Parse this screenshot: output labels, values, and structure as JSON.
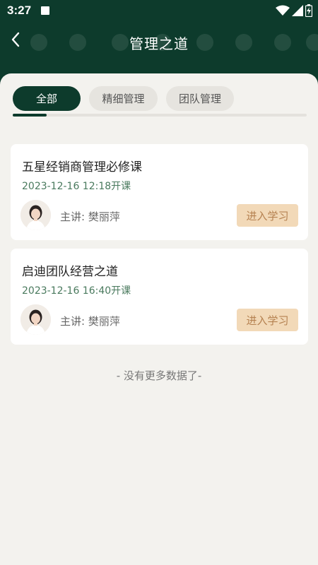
{
  "status_bar": {
    "time": "3:27",
    "icons": [
      "notification-a-icon",
      "wifi-icon",
      "signal-icon",
      "battery-icon"
    ]
  },
  "nav": {
    "title": "管理之道",
    "back_icon": "back-arrow-icon"
  },
  "tabs": [
    {
      "label": "全部",
      "active": true
    },
    {
      "label": "精细管理",
      "active": false
    },
    {
      "label": "团队管理",
      "active": false
    }
  ],
  "courses": [
    {
      "title": "五星经销商管理必修课",
      "time": "2023-12-16 12:18开课",
      "lecturer": "主讲: 樊丽萍",
      "button": "进入学习"
    },
    {
      "title": "启迪团队经营之道",
      "time": "2023-12-16 16:40开课",
      "lecturer": "主讲: 樊丽萍",
      "button": "进入学习"
    }
  ],
  "footer": {
    "no_more": "- 没有更多数据了-"
  },
  "colors": {
    "header_bg": "#0d3b2c",
    "page_bg": "#f3f2ee",
    "accent_time": "#4a7a5e",
    "button_bg": "#f2d9b8",
    "button_text": "#b58150"
  }
}
